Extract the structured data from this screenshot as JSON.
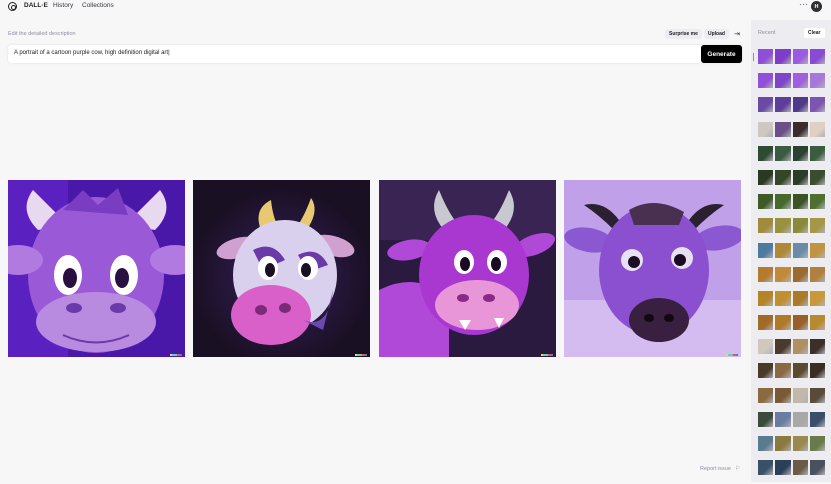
{
  "nav": {
    "brand": "DALL·E",
    "links": [
      "History",
      "Collections"
    ],
    "more": "···",
    "avatar_initial": "H"
  },
  "editor": {
    "label": "Edit the detailed description",
    "surprise_label": "Surprise me",
    "upload_label": "Upload",
    "prompt": "A portrait of a cartoon purple cow, high definition digital art",
    "generate_label": "Generate"
  },
  "results": {
    "count": 4,
    "report_label": "Report issue"
  },
  "sidebar": {
    "title": "Recent",
    "clear_label": "Clear",
    "rows": [
      [
        "#8e4fd6",
        "#7d3cc9",
        "#9b5be0",
        "#8a4ad4"
      ],
      [
        "#9050d8",
        "#7d45c8",
        "#9e60dc",
        "#a878d8"
      ],
      [
        "#6b4aa6",
        "#5e3e98",
        "#4f3a8a",
        "#7c55b0"
      ],
      [
        "#cfc8c0",
        "#6b5088",
        "#3a2c2a",
        "#e0d0c4"
      ],
      [
        "#2d4a33",
        "#3a5a42",
        "#2a4230",
        "#3c5c40"
      ],
      [
        "#2a3a22",
        "#334728",
        "#2c3d26",
        "#3a4d30"
      ],
      [
        "#3f5a26",
        "#466a2c",
        "#3b5424",
        "#4f6e30"
      ],
      [
        "#a08a3c",
        "#98923e",
        "#8a8a3a",
        "#a49846"
      ],
      [
        "#4e7aa0",
        "#b08838",
        "#6a8aa8",
        "#c09440"
      ],
      [
        "#b47a30",
        "#c08a38",
        "#9a6a30",
        "#b08040"
      ],
      [
        "#b48428",
        "#c09030",
        "#a87a2a",
        "#c8983a"
      ],
      [
        "#a06a28",
        "#b07a28",
        "#986028",
        "#b88a30"
      ],
      [
        "#d0c8bc",
        "#4a3a2c",
        "#b09060",
        "#3a3028"
      ],
      [
        "#4a3a28",
        "#8a6a40",
        "#5a4a30",
        "#3a2e22"
      ],
      [
        "#8a6a40",
        "#7a5a34",
        "#c0b8a8",
        "#5a4a38"
      ],
      [
        "#3a4a3c",
        "#6a7ca0",
        "#a8a8a8",
        "#3a4e6a"
      ],
      [
        "#5a7a90",
        "#8a7a40",
        "#9a8a50",
        "#6a7a48"
      ],
      [
        "#3a5068",
        "#2a4058",
        "#6a5a48",
        "#4a5060"
      ]
    ]
  }
}
